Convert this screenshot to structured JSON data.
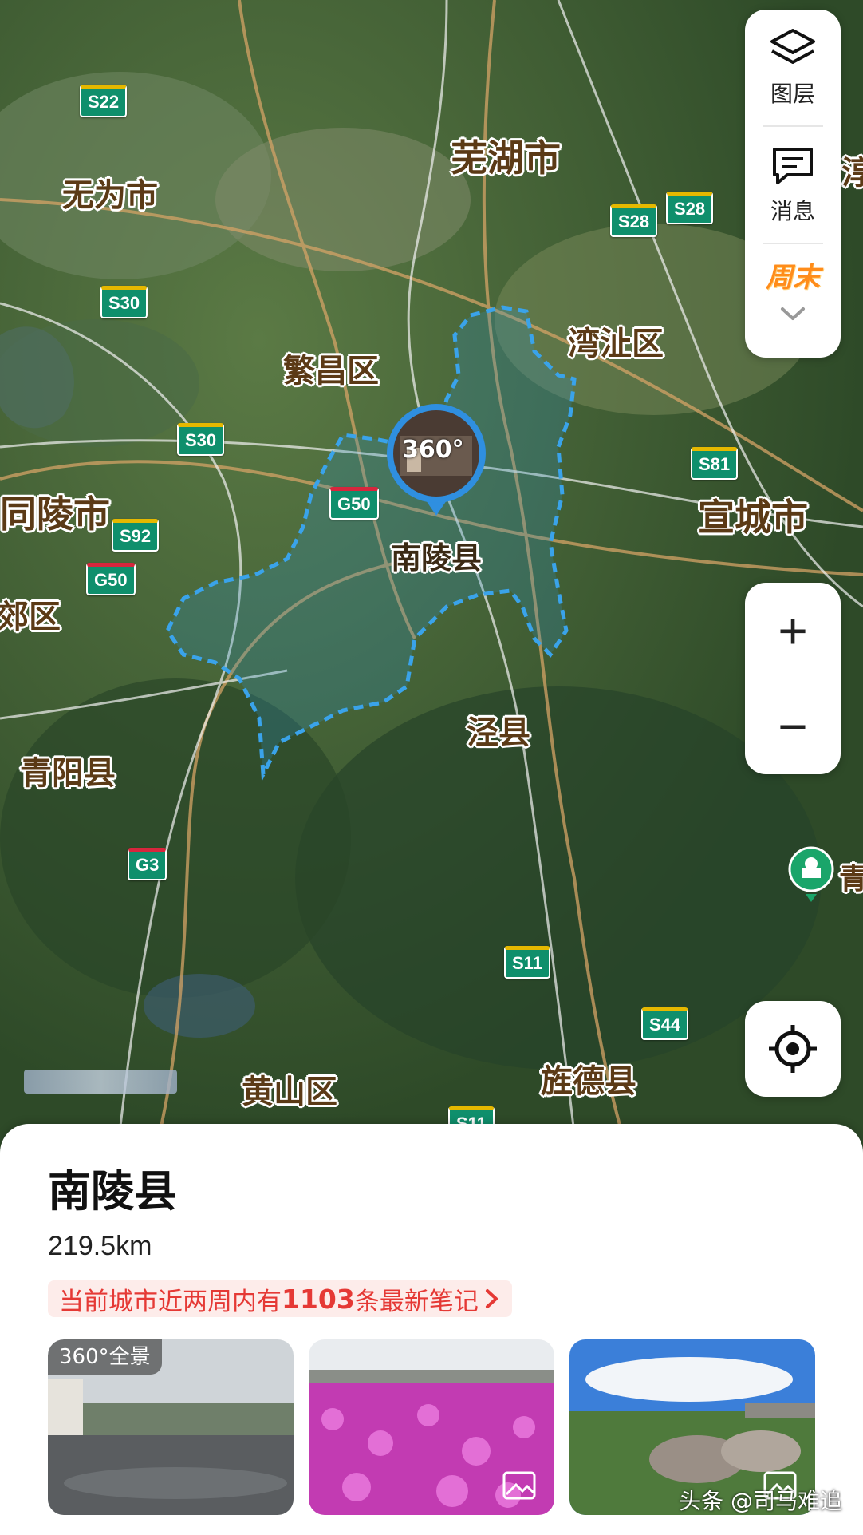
{
  "map": {
    "cities": [
      {
        "id": "wuhu",
        "label": "芜湖市"
      },
      {
        "id": "wuwei",
        "label": "无为市"
      },
      {
        "id": "fanchang",
        "label": "繁昌区"
      },
      {
        "id": "wanzhi",
        "label": "湾沚区"
      },
      {
        "id": "tongling",
        "label": "同陵市"
      },
      {
        "id": "xuancheng",
        "label": "宣城市"
      },
      {
        "id": "jingxian",
        "label": "泾县"
      },
      {
        "id": "qingyang",
        "label": "青阳县"
      },
      {
        "id": "huangshan",
        "label": "黄山区"
      },
      {
        "id": "jingde",
        "label": "旌德县"
      },
      {
        "id": "edge_qu",
        "label": "郊区"
      },
      {
        "id": "edge_right",
        "label": "淳"
      },
      {
        "id": "edge_qing",
        "label": "青"
      }
    ],
    "selected_place": "南陵县",
    "marker_badge": "360°",
    "highways": [
      {
        "id": "s22",
        "label": "S22",
        "kind": "s"
      },
      {
        "id": "s28a",
        "label": "S28",
        "kind": "s"
      },
      {
        "id": "s28b",
        "label": "S28",
        "kind": "s"
      },
      {
        "id": "s30a",
        "label": "S30",
        "kind": "s"
      },
      {
        "id": "s30b",
        "label": "S30",
        "kind": "s"
      },
      {
        "id": "g50a",
        "label": "G50",
        "kind": "g"
      },
      {
        "id": "g50b",
        "label": "G50",
        "kind": "g"
      },
      {
        "id": "s92",
        "label": "S92",
        "kind": "s"
      },
      {
        "id": "s81",
        "label": "S81",
        "kind": "s"
      },
      {
        "id": "g3",
        "label": "G3",
        "kind": "g"
      },
      {
        "id": "s11a",
        "label": "S11",
        "kind": "s"
      },
      {
        "id": "s11b",
        "label": "S11",
        "kind": "s"
      },
      {
        "id": "s44",
        "label": "S44",
        "kind": "s"
      }
    ]
  },
  "controls": {
    "layers_label": "图层",
    "messages_label": "消息",
    "weekend_label": "周末",
    "zoom_in": "+",
    "zoom_out": "−"
  },
  "sheet": {
    "title": "南陵县",
    "distance": "219.5km",
    "notes_prefix": "当前城市近两周内有",
    "notes_count": "1103",
    "notes_suffix": "条最新笔记",
    "panorama_badge": "360°全景",
    "watermark": "头条 @司马难追"
  },
  "colors": {
    "boundary": "#3aa3ea",
    "highway": "#0f8f6c",
    "notes_text": "#e53935",
    "place_label": "#5b3a16"
  }
}
